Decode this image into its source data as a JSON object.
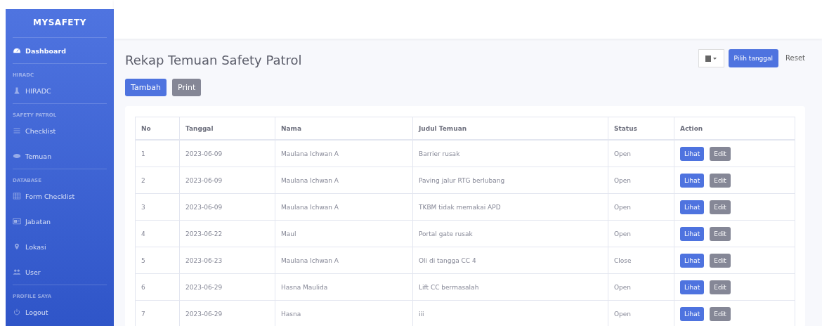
{
  "sidebar": {
    "brand": "MYSAFETY",
    "sections": [
      {
        "items": [
          {
            "label": "Dashboard",
            "kind": "gauge",
            "selected": true
          }
        ]
      },
      {
        "heading": "HIRADC",
        "items": [
          {
            "label": "HIRADC",
            "kind": "flask",
            "selected": false
          }
        ]
      },
      {
        "heading": "SAFETY PATROL",
        "items": [
          {
            "label": "Checklist",
            "kind": "list",
            "selected": false
          },
          {
            "label": "Temuan",
            "kind": "eye",
            "selected": false
          }
        ]
      },
      {
        "heading": "DATABASE",
        "items": [
          {
            "label": "Form Checklist",
            "kind": "table",
            "selected": false
          },
          {
            "label": "Jabatan",
            "kind": "card",
            "selected": false
          },
          {
            "label": "Lokasi",
            "kind": "pin",
            "selected": false
          },
          {
            "label": "User",
            "kind": "users",
            "selected": false
          }
        ]
      },
      {
        "heading": "PROFILE SAYA",
        "items": [
          {
            "label": "Logout",
            "kind": "power",
            "selected": false
          }
        ]
      }
    ]
  },
  "page": {
    "title": "Rekap Temuan Safety Patrol",
    "buttons": [
      "Tambah",
      "Print"
    ],
    "date_filter": {
      "apply": "Pilih tanggal",
      "reset": "Reset"
    }
  },
  "table": {
    "columns": [
      "No",
      "Tanggal",
      "Nama",
      "Judul Temuan",
      "Status",
      "Action"
    ],
    "rows": [
      {
        "no": "1",
        "tanggal": "2023-06-09",
        "nama": "Maulana Ichwan A",
        "judul": "Barrier rusak",
        "status": "Open",
        "actions": [
          "Lihat",
          "Edit"
        ]
      },
      {
        "no": "2",
        "tanggal": "2023-06-09",
        "nama": "Maulana Ichwan A",
        "judul": "Paving jalur RTG berlubang",
        "status": "Open",
        "actions": [
          "Lihat",
          "Edit"
        ]
      },
      {
        "no": "3",
        "tanggal": "2023-06-09",
        "nama": "Maulana Ichwan A",
        "judul": "TKBM tidak memakai APD",
        "status": "Open",
        "actions": [
          "Lihat",
          "Edit"
        ]
      },
      {
        "no": "4",
        "tanggal": "2023-06-22",
        "nama": "Maul",
        "judul": "Portal gate rusak",
        "status": "Open",
        "actions": [
          "Lihat",
          "Edit"
        ]
      },
      {
        "no": "5",
        "tanggal": "2023-06-23",
        "nama": "Maulana Ichwan A",
        "judul": "Oli di tangga CC 4",
        "status": "Close",
        "actions": [
          "Lihat",
          "Edit"
        ]
      },
      {
        "no": "6",
        "tanggal": "2023-06-29",
        "nama": "Hasna Maulida",
        "judul": "Lift CC bermasalah",
        "status": "Open",
        "actions": [
          "Lihat",
          "Edit"
        ]
      },
      {
        "no": "7",
        "tanggal": "2023-06-29",
        "nama": "Hasna",
        "judul": "iii",
        "status": "Open",
        "actions": [
          "Lihat",
          "Edit"
        ]
      }
    ]
  }
}
